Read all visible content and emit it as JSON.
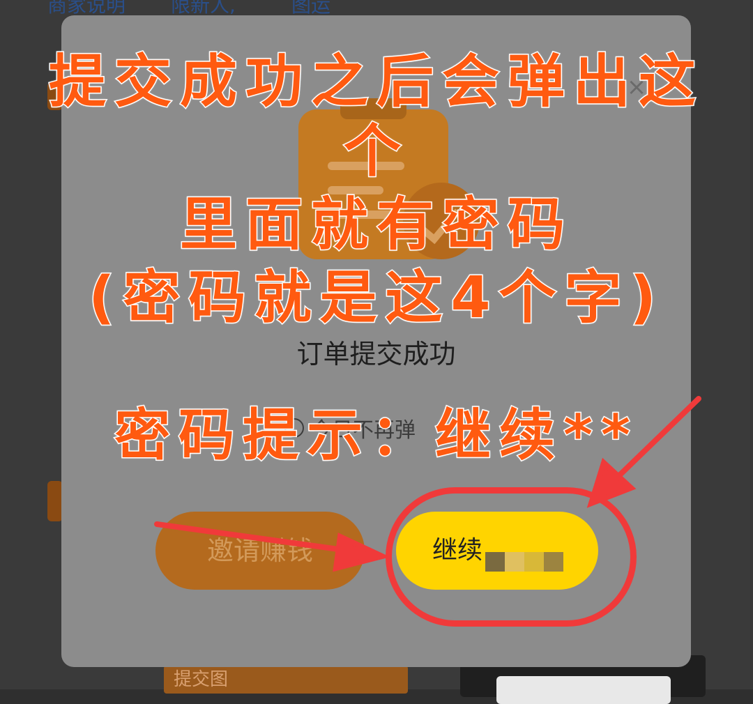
{
  "background": {
    "top_links": [
      "商家说明",
      "限新人,",
      "图运"
    ],
    "submit_label": "提交图"
  },
  "modal": {
    "title": "订单提交成功",
    "no_popup_text": "今日不再弹",
    "buttons": {
      "invite_label": "邀请赚钱",
      "continue_label": "继续"
    },
    "close_icon": "close-icon",
    "hero_icon": "clipboard-check-icon"
  },
  "annotations": {
    "line1": "提交成功之后会弹出这",
    "line2": "个",
    "line3": "里面就有密码",
    "line4": "(密码就是这4个字)",
    "hint": "密码提示：继续**"
  },
  "colors": {
    "annotation_text": "#ff5a10",
    "annotation_outline": "#ffffff",
    "highlight_ring": "#f03a3a",
    "continue_button": "#ffd400",
    "invite_button": "#b46a1e",
    "modal_bg": "#8c8c8c"
  }
}
